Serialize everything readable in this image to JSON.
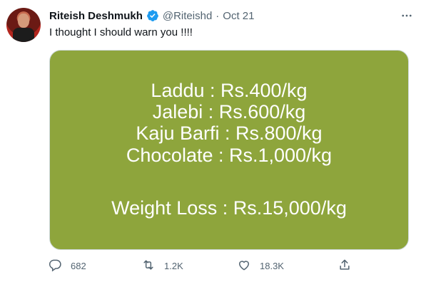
{
  "tweet": {
    "display_name": "Riteish Deshmukh",
    "handle": "@Riteishd",
    "separator": "·",
    "date": "Oct 21",
    "text": "I thought I should warn you !!!!",
    "media_lines": [
      "Laddu : Rs.400/kg",
      "Jalebi : Rs.600/kg",
      "Kaju Barfi : Rs.800/kg",
      "Chocolate : Rs.1,000/kg",
      "Weight Loss : Rs.15,000/kg"
    ],
    "media_background": "#8ea53c",
    "counts": {
      "replies": "682",
      "retweets": "1.2K",
      "likes": "18.3K"
    }
  },
  "colors": {
    "verified_blue": "#1d9bf0",
    "secondary_text": "#536471"
  }
}
